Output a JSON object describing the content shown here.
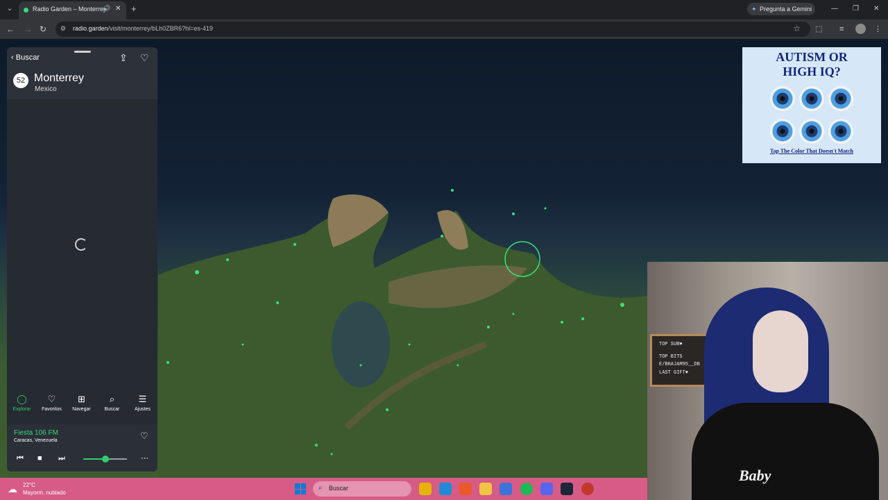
{
  "browser": {
    "tab_title": "Radio Garden – Monterrey",
    "tab_list_icon": "⌄",
    "tab_audio_icon": "🔊",
    "tab_close_icon": "✕",
    "new_tab_icon": "+",
    "gemini_label": "Pregunta a Gemini",
    "gemini_icon": "✦",
    "window_minimize": "—",
    "window_restore": "❐",
    "window_close": "✕",
    "back_icon": "←",
    "forward_icon": "→",
    "reload_icon": "↻",
    "site_info_icon": "⚙",
    "url_host": "radio.garden",
    "url_path": "/visit/monterrey/bLh0ZBR6?hl=es-419",
    "bookmark_icon": "☆",
    "extensions_icon": "⬚",
    "media_icon": "≡",
    "menu_icon": "⋮",
    "accent_color": "#2fe07a"
  },
  "panel": {
    "back_label": "Buscar",
    "back_icon": "‹",
    "share_icon": "⇪",
    "favorite_icon": "♡",
    "station_count": "52",
    "city": "Monterrey",
    "country": "Mexico",
    "nav": [
      {
        "label": "Explorar",
        "icon": "◯",
        "active": true
      },
      {
        "label": "Favoritos",
        "icon": "♡",
        "active": false
      },
      {
        "label": "Navegar",
        "icon": "⊞",
        "active": false
      },
      {
        "label": "Buscar",
        "icon": "⌕",
        "active": false
      },
      {
        "label": "Ajustes",
        "icon": "☰",
        "active": false
      }
    ],
    "accent_color": "#2ed06e"
  },
  "player": {
    "station_name": "Fiesta 106 FM",
    "station_location": "Caracas, Venezuela",
    "favorite_icon": "♡",
    "prev_icon": "⏮",
    "stop_icon": "■",
    "next_icon": "⏭",
    "more_icon": "⋯",
    "volume": 0.5
  },
  "ad": {
    "headline_line1": "AUTISM OR",
    "headline_line2": "HIGH IQ?",
    "cta": "Tap The Color That Doesn't Match"
  },
  "webcam": {
    "board_lines": [
      "TOP SUB♥",
      "TOP BITS",
      "E/BRAJAM95__DB",
      "LAST GIFT♥"
    ],
    "shirt_text": "Baby"
  },
  "taskbar": {
    "temperature": "22°C",
    "condition": "Mayorm. nublado",
    "weather_icon": "☁",
    "search_placeholder": "Buscar",
    "search_icon": "⌕",
    "color": "#d65b86"
  }
}
